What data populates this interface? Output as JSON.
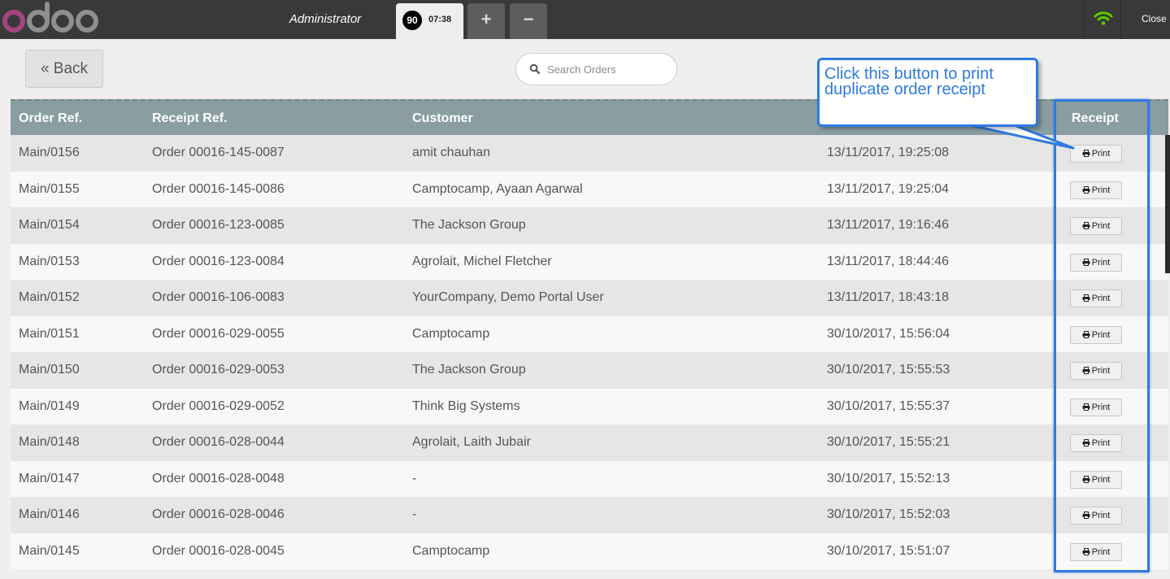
{
  "topbar": {
    "logo_text": "odoo",
    "username": "Administrator",
    "order_tab": {
      "badge": "90",
      "time": "07:38"
    },
    "add_order_label": "+",
    "remove_order_label": "−",
    "close_label": "Close",
    "wifi_color": "#5ec900"
  },
  "subheader": {
    "back_label": "« Back",
    "search_placeholder": "Search Orders"
  },
  "table": {
    "headers": [
      "Order Ref.",
      "Receipt Ref.",
      "Customer",
      "",
      "Receipt"
    ],
    "print_label": "Print",
    "rows": [
      {
        "order_ref": "Main/0156",
        "receipt_ref": "Order 00016-145-0087",
        "customer": "amit chauhan",
        "date": "13/11/2017, 19:25:08"
      },
      {
        "order_ref": "Main/0155",
        "receipt_ref": "Order 00016-145-0086",
        "customer": "Camptocamp, Ayaan Agarwal",
        "date": "13/11/2017, 19:25:04"
      },
      {
        "order_ref": "Main/0154",
        "receipt_ref": "Order 00016-123-0085",
        "customer": "The Jackson Group",
        "date": "13/11/2017, 19:16:46"
      },
      {
        "order_ref": "Main/0153",
        "receipt_ref": "Order 00016-123-0084",
        "customer": "Agrolait, Michel Fletcher",
        "date": "13/11/2017, 18:44:46"
      },
      {
        "order_ref": "Main/0152",
        "receipt_ref": "Order 00016-106-0083",
        "customer": "YourCompany, Demo Portal User",
        "date": "13/11/2017, 18:43:18"
      },
      {
        "order_ref": "Main/0151",
        "receipt_ref": "Order 00016-029-0055",
        "customer": "Camptocamp",
        "date": "30/10/2017, 15:56:04"
      },
      {
        "order_ref": "Main/0150",
        "receipt_ref": "Order 00016-029-0053",
        "customer": "The Jackson Group",
        "date": "30/10/2017, 15:55:53"
      },
      {
        "order_ref": "Main/0149",
        "receipt_ref": "Order 00016-029-0052",
        "customer": "Think Big Systems",
        "date": "30/10/2017, 15:55:37"
      },
      {
        "order_ref": "Main/0148",
        "receipt_ref": "Order 00016-028-0044",
        "customer": "Agrolait, Laith Jubair",
        "date": "30/10/2017, 15:55:21"
      },
      {
        "order_ref": "Main/0147",
        "receipt_ref": "Order 00016-028-0048",
        "customer": "-",
        "date": "30/10/2017, 15:52:13"
      },
      {
        "order_ref": "Main/0146",
        "receipt_ref": "Order 00016-028-0046",
        "customer": "-",
        "date": "30/10/2017, 15:52:03"
      },
      {
        "order_ref": "Main/0145",
        "receipt_ref": "Order 00016-028-0045",
        "customer": "Camptocamp",
        "date": "30/10/2017, 15:51:07"
      }
    ]
  },
  "annotation": {
    "callout_text": "Click this button to print duplicate order receipt",
    "color": "#2e7ae0"
  }
}
